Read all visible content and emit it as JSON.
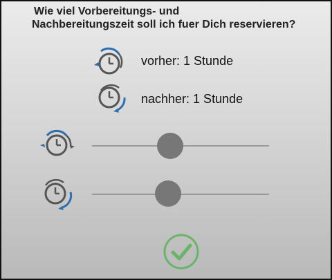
{
  "dialog": {
    "question_line1": "Wie viel Vorbereitungs- und",
    "question_line2": "Nachbereitungszeit soll ich fuer Dich reservieren?"
  },
  "summary": {
    "before_label": "vorher: 1 Stunde",
    "after_label": "nachher: 1 Stunde"
  },
  "sliders": {
    "before_value_fraction": 0.44,
    "after_value_fraction": 0.43
  },
  "icons": {
    "before": "clock-counterclockwise-icon",
    "after": "clock-clockwise-icon",
    "confirm": "checkmark-icon"
  },
  "colors": {
    "accent_blue": "#2e6fb0",
    "clock_gray": "#555555",
    "confirm_green": "#6ab46a"
  }
}
